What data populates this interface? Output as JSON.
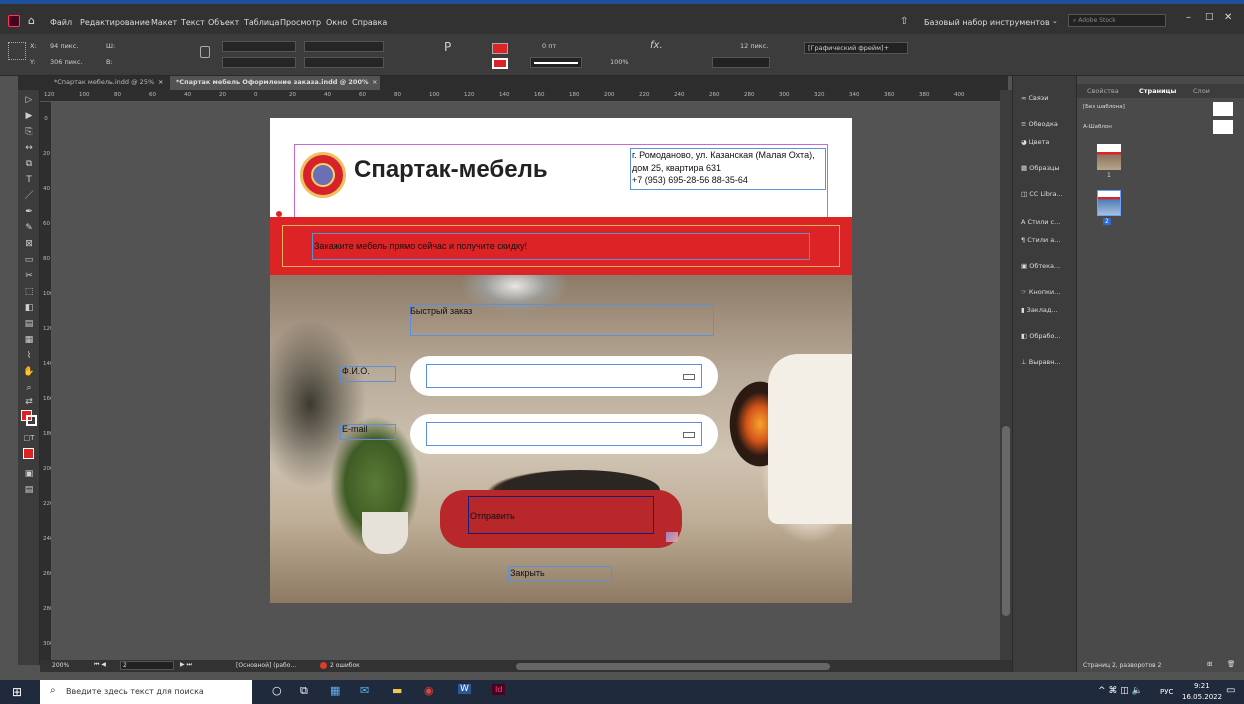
{
  "menu": {
    "items": [
      "Файл",
      "Редактирование",
      "Макет",
      "Текст",
      "Объект",
      "Таблица",
      "Просмотр",
      "Окно",
      "Справка"
    ],
    "workspace": "Базовый набор инструментов",
    "search_placeholder": "Adobe Stock"
  },
  "control": {
    "x_label": "X:",
    "x_value": "94 пикс.",
    "y_label": "Y:",
    "y_value": "306 пикс.",
    "w_label": "Ш:",
    "h_label": "В:",
    "stroke_value": "0 пт",
    "zoom_value": "100%",
    "size_value": "12 пикс.",
    "frame_style": "[Графический фрейм]+"
  },
  "tabs": [
    {
      "label": "*Спартак мебель.indd @ 25%"
    },
    {
      "label": "*Спартак мебель Оформление заказа.indd @ 200%"
    }
  ],
  "ruler": {
    "h_ticks": [
      "120",
      "100",
      "80",
      "60",
      "40",
      "20",
      "0",
      "20",
      "40",
      "60",
      "80",
      "100",
      "120",
      "140",
      "160",
      "180",
      "200",
      "220",
      "240",
      "260",
      "280",
      "300",
      "320",
      "340",
      "360",
      "380",
      "400"
    ],
    "v_ticks": [
      "0",
      "20",
      "40",
      "60",
      "80",
      "100",
      "120",
      "140",
      "160",
      "180",
      "200",
      "220",
      "240",
      "260",
      "280",
      "300"
    ]
  },
  "document": {
    "company": "Спартак-мебель",
    "address_line1": "г. Ромоданово, ул. Казанская (Малая Охта),",
    "address_line2": "дом 25, квартира 631",
    "address_line3": "+7 (953) 695-28-56    88-35-64",
    "banner": "Закажите мебель прямо сейчас и получите скидку!",
    "form_title": "Быстрый заказ",
    "name_label": "Ф.И.О.",
    "email_label": "E-mail",
    "submit": "Отправить",
    "close": "Закрыть"
  },
  "statusbar": {
    "zoom": "200%",
    "page": "2",
    "profile": "[Основной] (рабо...",
    "errors": "2 ошибок"
  },
  "panel_icons": [
    "Связи",
    "Обводка",
    "Цвета",
    "Образцы",
    "CC Libra...",
    "Стили с...",
    "Стили а...",
    "Обтека...",
    "Кнопки...",
    "Заклад...",
    "Обрабо...",
    "Выравн..."
  ],
  "panel_tabs": [
    "Свойства",
    "Страницы",
    "Слои"
  ],
  "pages_panel": {
    "none_master": "[Без шаблона]",
    "a_master": "А-Шаблон",
    "page1": "1",
    "page2": "2",
    "footer": "Страниц 2, разворотов 2"
  },
  "taskbar": {
    "search_placeholder": "Введите здесь текст для поиска",
    "lang": "РУС",
    "time": "9:21",
    "date": "16.05.2022"
  },
  "colors": {
    "accent": "#dc2426",
    "submit": "#b8282a",
    "frame": "#5f8fd6"
  }
}
